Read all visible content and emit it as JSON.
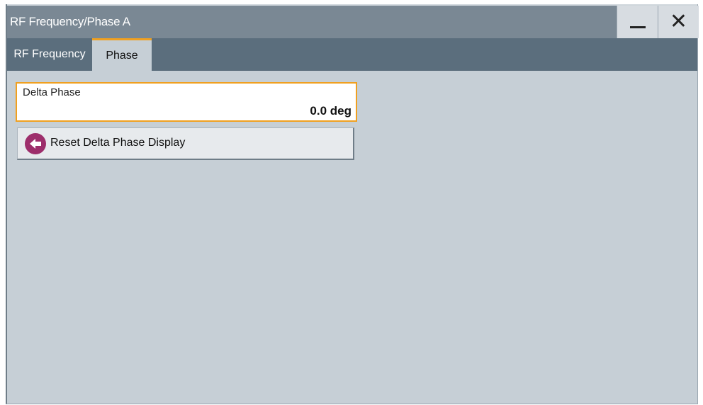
{
  "window": {
    "title": "RF Frequency/Phase A",
    "minimize_icon": "minimize-icon",
    "close_icon": "close-icon",
    "close_glyph": "✕"
  },
  "tabs": [
    {
      "label": "RF Frequency",
      "active": false
    },
    {
      "label": "Phase",
      "active": true
    }
  ],
  "delta_phase": {
    "label": "Delta Phase",
    "value": "0.0 deg"
  },
  "reset_button": {
    "label": "Reset Delta Phase Display",
    "icon": "arrow-left-icon"
  },
  "colors": {
    "accent": "#f0a020",
    "icon_circle": "#9d2e6b",
    "titlebar": "#7a8894",
    "tabbar": "#5b6e7d",
    "panel": "#c6cfd6"
  }
}
